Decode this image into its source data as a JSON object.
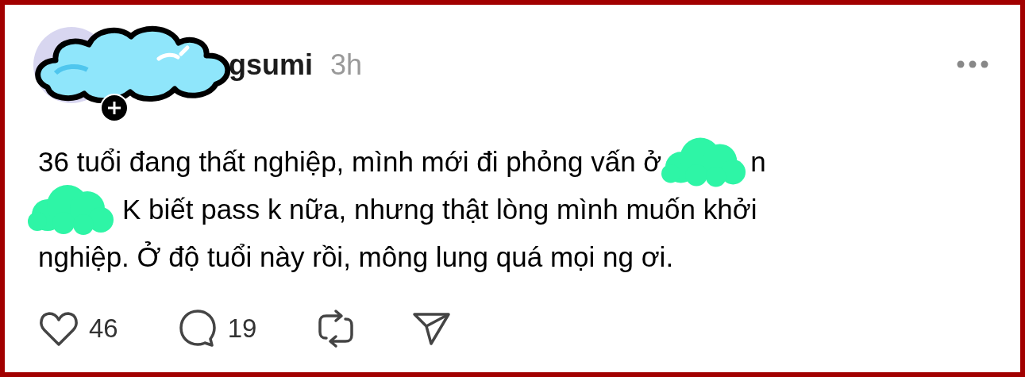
{
  "post": {
    "author": {
      "name": "gsumi"
    },
    "time": "3h",
    "lines": [
      [
        {
          "kind": "text",
          "text": "36 tuổi đang thất nghiệp, mình mới đi phỏng vấn ở"
        },
        {
          "kind": "sticker"
        },
        {
          "kind": "text",
          "text": "n"
        }
      ],
      [
        {
          "kind": "sticker"
        },
        {
          "kind": "text",
          "text": "K biết pass k nữa, nhưng thật lòng mình muốn khởi"
        }
      ],
      [
        {
          "kind": "text",
          "text": "nghiệp. Ở độ tuổi này rồi, mông lung quá mọi ng ơi."
        }
      ]
    ],
    "actions": [
      {
        "kind": "like",
        "count": "46"
      },
      {
        "kind": "comment",
        "count": "19"
      },
      {
        "kind": "repost"
      },
      {
        "kind": "share"
      }
    ]
  }
}
